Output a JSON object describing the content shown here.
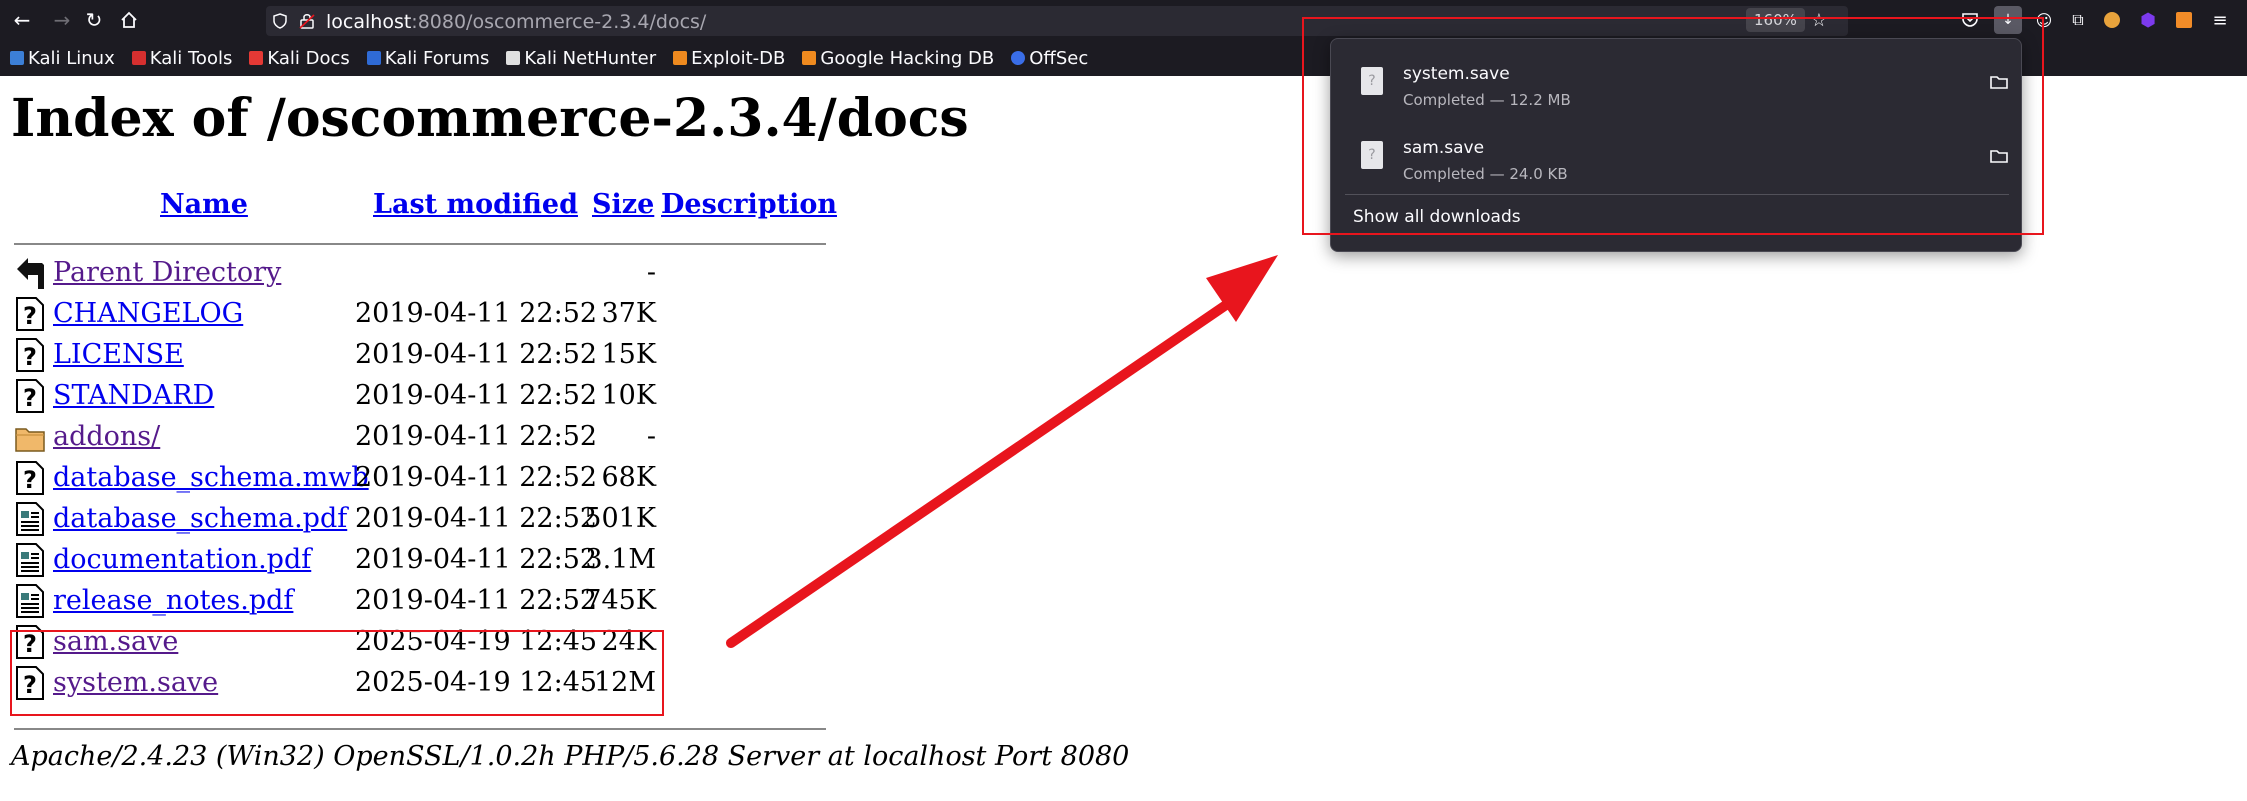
{
  "browser": {
    "url_host": "localhost",
    "url_rest": ":8080/oscommerce-2.3.4/docs/",
    "zoom": "160%"
  },
  "bookmarks": [
    {
      "label": "Kali Linux",
      "color": "#3c7fd6"
    },
    {
      "label": "Kali Tools",
      "color": "#d62f2f"
    },
    {
      "label": "Kali Docs",
      "color": "#e53935"
    },
    {
      "label": "Kali Forums",
      "color": "#2f6bd6"
    },
    {
      "label": "Kali NetHunter",
      "color": "#e0e0e0"
    },
    {
      "label": "Exploit-DB",
      "color": "#ef8a1f"
    },
    {
      "label": "Google Hacking DB",
      "color": "#ef8a1f"
    },
    {
      "label": "OffSec",
      "color": "#3a6ee8"
    }
  ],
  "page": {
    "title": "Index of /oscommerce-2.3.4/docs",
    "headers": {
      "name": "Name",
      "last_modified": "Last modified",
      "size": "Size",
      "description": "Description"
    },
    "rows": [
      {
        "name": "Parent Directory",
        "date": "",
        "size": "-",
        "icon": "back-icon",
        "visited": true
      },
      {
        "name": "CHANGELOG",
        "date": "2019-04-11 22:52",
        "size": "37K",
        "icon": "unknown-file-icon",
        "visited": false
      },
      {
        "name": "LICENSE",
        "date": "2019-04-11 22:52",
        "size": "15K",
        "icon": "unknown-file-icon",
        "visited": false
      },
      {
        "name": "STANDARD",
        "date": "2019-04-11 22:52",
        "size": "10K",
        "icon": "unknown-file-icon",
        "visited": false
      },
      {
        "name": "addons/",
        "date": "2019-04-11 22:52",
        "size": "-",
        "icon": "folder-icon",
        "visited": true
      },
      {
        "name": "database_schema.mwb",
        "date": "2019-04-11 22:52",
        "size": "68K",
        "icon": "unknown-file-icon",
        "visited": false
      },
      {
        "name": "database_schema.pdf",
        "date": "2019-04-11 22:52",
        "size": "501K",
        "icon": "layout-file-icon",
        "visited": false
      },
      {
        "name": "documentation.pdf",
        "date": "2019-04-11 22:52",
        "size": "3.1M",
        "icon": "layout-file-icon",
        "visited": false
      },
      {
        "name": "release_notes.pdf",
        "date": "2019-04-11 22:52",
        "size": "745K",
        "icon": "layout-file-icon",
        "visited": false
      },
      {
        "name": "sam.save",
        "date": "2025-04-19 12:45",
        "size": "24K",
        "icon": "unknown-file-icon",
        "visited": true
      },
      {
        "name": "system.save",
        "date": "2025-04-19 12:45",
        "size": "12M",
        "icon": "unknown-file-icon",
        "visited": true
      }
    ],
    "address": "Apache/2.4.23 (Win32) OpenSSL/1.0.2h PHP/5.6.28 Server at localhost Port 8080"
  },
  "downloads": {
    "items": [
      {
        "name": "system.save",
        "status": "Completed — 12.2 MB"
      },
      {
        "name": "sam.save",
        "status": "Completed — 24.0 KB"
      }
    ],
    "show_all": "Show all downloads"
  },
  "annotation_color": "#e8151d"
}
